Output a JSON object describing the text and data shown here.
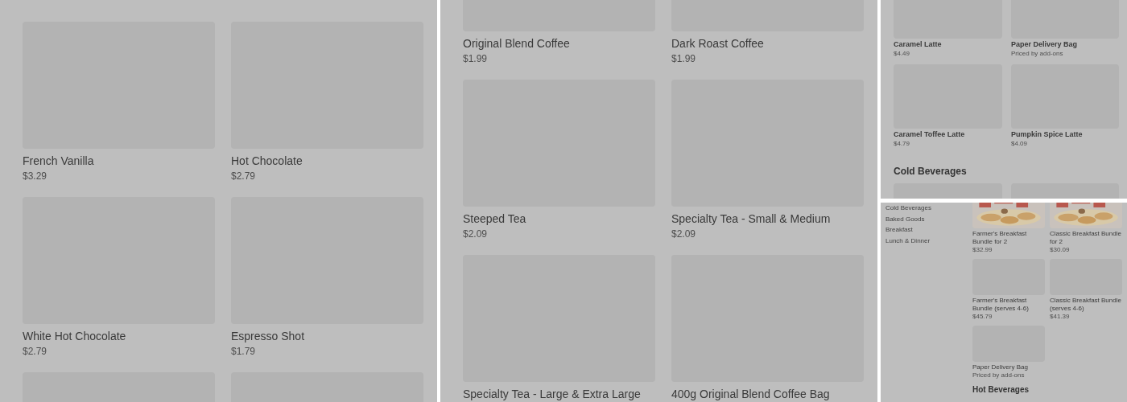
{
  "views": [
    {
      "kind": "large",
      "sections": [
        {
          "items": [
            {
              "name": "French Vanilla",
              "price": "$3.29"
            },
            {
              "name": "Hot Chocolate",
              "price": "$2.79"
            },
            {
              "name": "White Hot Chocolate",
              "price": "$2.79"
            },
            {
              "name": "Espresso Shot",
              "price": "$1.79"
            }
          ]
        }
      ]
    },
    {
      "kind": "large_offset",
      "sections": [
        {
          "items": [
            {
              "name": "Original Blend Coffee",
              "price": "$1.99"
            },
            {
              "name": "Dark Roast Coffee",
              "price": "$1.99"
            },
            {
              "name": "Steeped Tea",
              "price": "$2.09"
            },
            {
              "name": "Specialty Tea - Small & Medium",
              "price": "$2.09"
            },
            {
              "name": "Specialty Tea - Large & Extra Large"
            },
            {
              "name": "400g Original Blend Coffee Bag"
            }
          ]
        }
      ]
    },
    {
      "kind": "medium",
      "sections": [
        {
          "items": [
            {
              "name": "Caramel Latte",
              "price": "$4.49"
            },
            {
              "name": "Paper Delivery Bag",
              "price": "Priced by add-ons"
            },
            {
              "name": "Caramel Toffee Latte",
              "price": "$4.79"
            },
            {
              "name": "Pumpkin Spice Latte",
              "price": "$4.09"
            }
          ]
        },
        {
          "heading": "Cold Beverages"
        }
      ]
    },
    {
      "kind": "small",
      "sidebar": [
        "Cold Beverages",
        "Baked Goods",
        "Breakfast",
        "Lunch & Dinner"
      ],
      "sections": [
        {
          "items": [
            {
              "name": "Farmer's Breakfast Bundle for 2",
              "price": "$32.99",
              "kind": "picture"
            },
            {
              "name": "Classic Breakfast Bundle for 2",
              "price": "$30.09",
              "kind": "picture"
            },
            {
              "name": "Farmer's Breakfast Bundle (serves 4-6)",
              "price": "$45.79"
            },
            {
              "name": "Classic Breakfast Bundle (serves 4-6)",
              "price": "$41.39"
            },
            {
              "name": "Paper Delivery Bag",
              "price": "Priced by add-ons"
            }
          ]
        },
        {
          "heading": "Hot Beverages"
        }
      ]
    }
  ]
}
